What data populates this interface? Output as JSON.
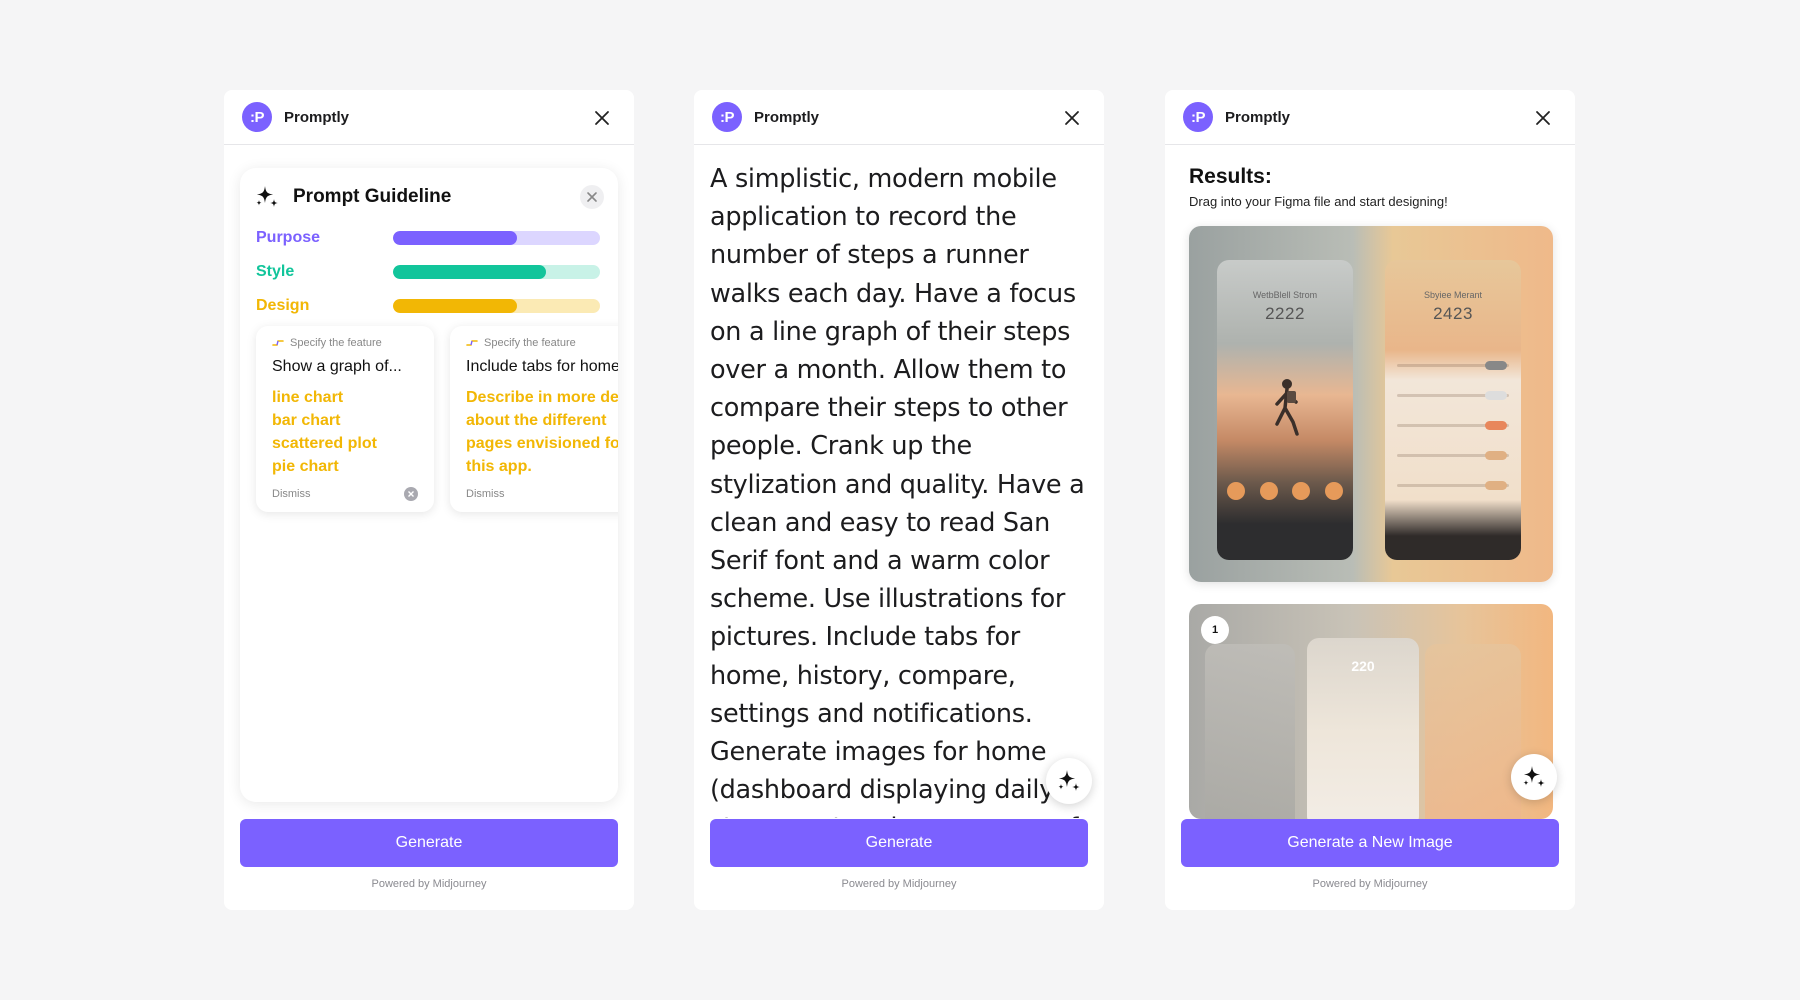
{
  "brand": {
    "logo_text": ":P",
    "app_name": "Promptly",
    "accent": "#7b61ff"
  },
  "panel1": {
    "guideline_title": "Prompt Guideline",
    "metrics": [
      {
        "label": "Purpose",
        "color": "#7b61ff",
        "track": "#dcd6ff",
        "level": 0.6
      },
      {
        "label": "Style",
        "color": "#12c59b",
        "track": "#c8f2e7",
        "level": 0.74
      },
      {
        "label": "Design",
        "color": "#f2b705",
        "track": "#fbeab4",
        "level": 0.6
      }
    ],
    "suggestions": [
      {
        "hint": "Specify the feature",
        "title": "Show a graph of...",
        "options": [
          "line chart",
          "bar chart",
          "scattered plot",
          "pie chart"
        ],
        "dismiss": "Dismiss"
      },
      {
        "hint": "Specify the feature",
        "title": "Include tabs for home",
        "description": [
          "Describe in more detail",
          "about the different",
          "pages envisioned for",
          "this app."
        ],
        "dismiss": "Dismiss"
      }
    ],
    "generate_label": "Generate",
    "powered_by": "Powered by Midjourney"
  },
  "panel2": {
    "prompt_text": "A simplistic, modern mobile application to record the number of steps a runner walks each day. Have a focus on a line graph of their steps over a month. Allow them to compare their steps to other people. Crank up the stylization and quality. Have a clean and easy to read San Serif font and a warm color scheme. Use illustrations for pictures. Include tabs for home, history, compare, settings and notifications. Generate images for home (dashboard displaying daily step count and a summary of the",
    "generate_label": "Generate",
    "powered_by": "Powered by Midjourney"
  },
  "panel3": {
    "results_title": "Results:",
    "results_subtitle": "Drag into your Figma file and start designing!",
    "image1": {
      "left_name": "WetbBlell Strom",
      "left_number": "2222",
      "right_name": "Sbyiee Merant",
      "right_number": "2423"
    },
    "image2": {
      "badge": "1",
      "center_number": "220"
    },
    "generate_label": "Generate a New Image",
    "powered_by": "Powered by Midjourney"
  },
  "icons": {
    "close": "close-icon",
    "sparkle": "sparkle-icon",
    "dismiss": "dismiss-icon"
  }
}
